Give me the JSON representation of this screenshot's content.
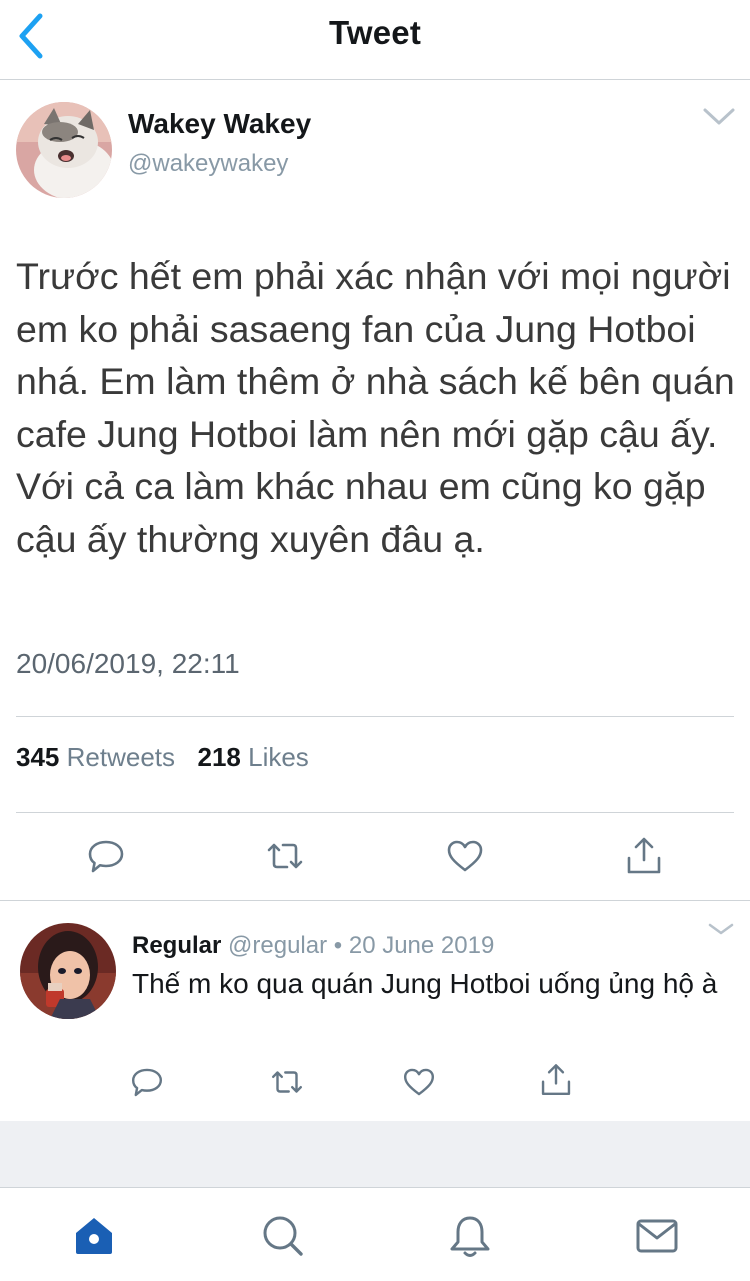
{
  "header": {
    "title": "Tweet",
    "back_icon": "chevron-left-icon"
  },
  "tweet": {
    "author_name": "Wakey Wakey",
    "author_handle": "@wakeywakey",
    "avatar_icon": "cat-avatar",
    "text": "Trước hết em phải xác nhận với mọi người em ko phải sasaeng fan của Jung Hotboi nhá. Em làm thêm ở nhà sách kế bên quán cafe Jung Hotboi làm nên mới gặp cậu ấy. Với cả ca làm khác nhau em cũng ko gặp cậu ấy thường xuyên đâu ạ.",
    "timestamp": "20/06/2019, 22:11",
    "retweets_count": "345",
    "retweets_label": "Retweets",
    "likes_count": "218",
    "likes_label": "Likes",
    "actions": [
      "reply-icon",
      "retweet-icon",
      "like-icon",
      "share-icon"
    ]
  },
  "reply": {
    "author_name": "Regular",
    "meta": "@regular • 20 June 2019",
    "text": "Thế m ko qua quán Jung Hotboi uống ủng hộ à",
    "avatar_icon": "cartoon-girl-avatar",
    "actions": [
      "reply-icon",
      "retweet-icon",
      "like-icon",
      "share-icon"
    ]
  },
  "tabbar": {
    "items": [
      "home-icon",
      "search-icon",
      "notifications-icon",
      "messages-icon"
    ],
    "active": "home-icon"
  },
  "colors": {
    "accent": "#1da1f2",
    "tab_active": "#1a5fb4",
    "icon_gray": "#657786",
    "text_secondary": "#8899a6",
    "divider": "#cfd4d8"
  }
}
